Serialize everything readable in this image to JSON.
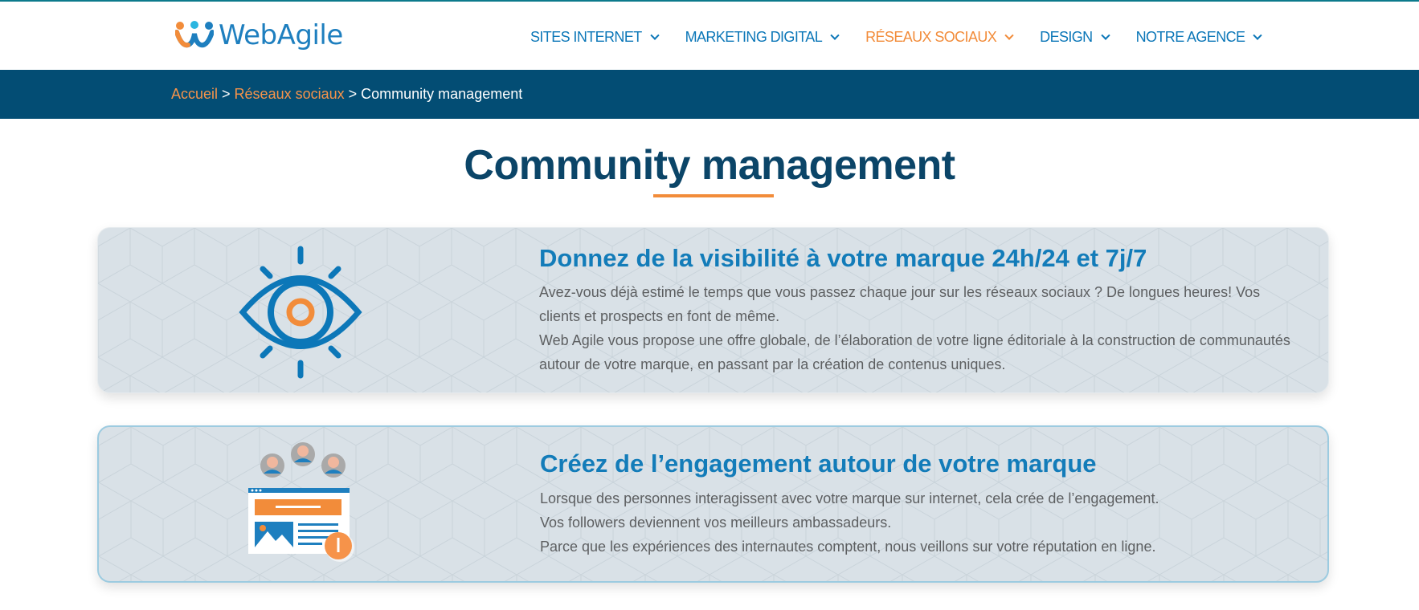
{
  "brand": {
    "name": "WebAgile",
    "colors": {
      "blue": "#1e7fbf",
      "orange": "#f28c3a",
      "navy": "#034d74",
      "cyan": "#2bb6e0"
    }
  },
  "nav": {
    "items": [
      {
        "label": "SITES INTERNET",
        "active": false
      },
      {
        "label": "MARKETING DIGITAL",
        "active": false
      },
      {
        "label": "RÉSEAUX SOCIAUX",
        "active": true
      },
      {
        "label": "DESIGN",
        "active": false
      },
      {
        "label": "NOTRE AGENCE",
        "active": false
      }
    ]
  },
  "breadcrumb": {
    "home": "Accueil",
    "section": "Réseaux sociaux",
    "current": "Community management",
    "separator": ">"
  },
  "page": {
    "title": "Community management"
  },
  "cards": [
    {
      "icon": "eye-icon",
      "title": "Donnez de la visibilité à votre marque 24h/24 et 7j/7",
      "lines": [
        "Avez-vous déjà estimé le temps que vous passez chaque jour sur les réseaux sociaux ? De longues heures! Vos clients et prospects en font de même.",
        "Web Agile vous propose une offre globale, de l’élaboration de votre ligne éditoriale à la construction de communautés autour de votre marque, en passant par la création de contenus uniques."
      ]
    },
    {
      "icon": "community-engagement-icon",
      "title": "Créez de l’engagement autour de votre marque",
      "lines": [
        "Lorsque des personnes interagissent avec votre marque sur internet, cela crée de l’engagement.",
        "Vos followers deviennent vos meilleurs ambassadeurs.",
        "Parce que les expériences des internautes comptent, nous veillons sur votre réputation en ligne."
      ]
    }
  ]
}
